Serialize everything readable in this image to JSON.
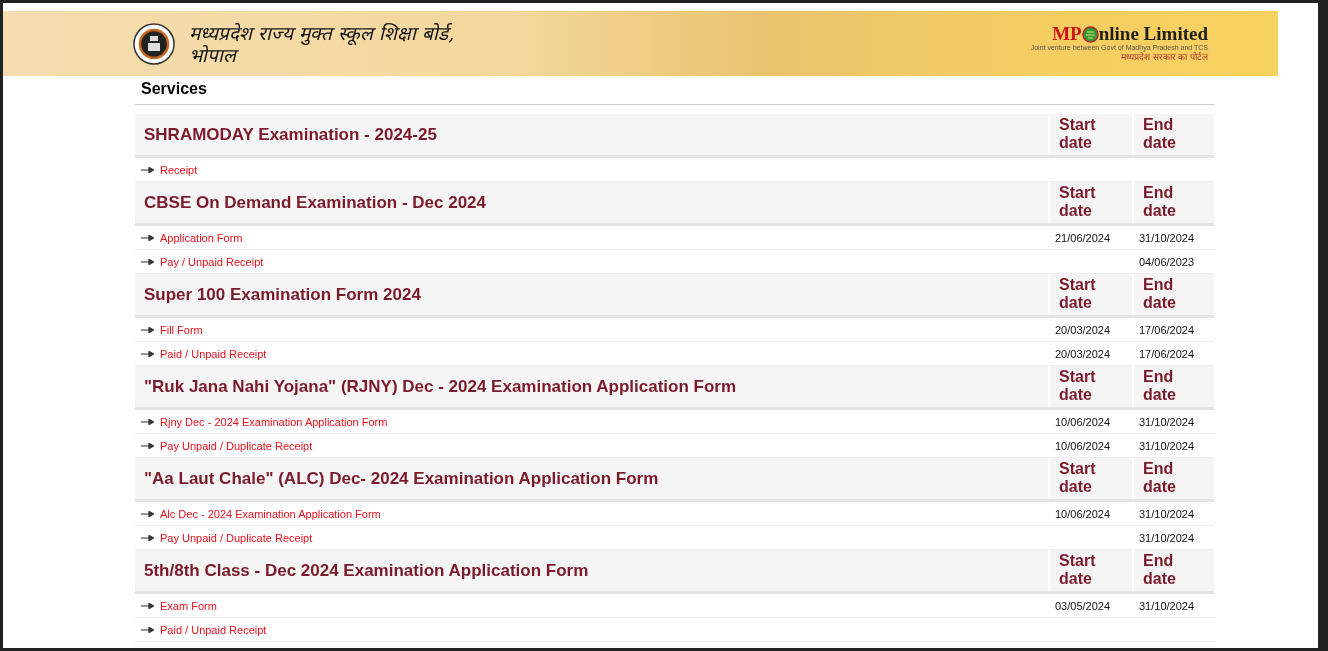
{
  "header": {
    "board_name": "मध्यप्रदेश राज्य मुक्त स्कूल शिक्षा बोर्ड, भोपाल",
    "partner_logo": {
      "brand_a": "MP",
      "brand_b": "nline Limited",
      "fine_print": "Joint venture between Govt of Madhya Pradesh and TCS",
      "tagline": "मध्यप्रदेश सरकार का पोर्टल"
    }
  },
  "page_title": "Services",
  "sections": [
    {
      "title": "SHRAMODAY Examination - 2024-25",
      "start_heading": "Start date",
      "end_heading": "End date",
      "links": [
        {
          "label": "Receipt"
        }
      ]
    },
    {
      "title": "CBSE On Demand Examination - Dec 2024",
      "start_heading": "Start date",
      "end_heading": "End date",
      "links": [
        {
          "label": "Application Form",
          "start": "21/06/2024",
          "end": "31/10/2024"
        },
        {
          "label": "Pay / Unpaid Receipt",
          "end": "04/06/2023"
        }
      ]
    },
    {
      "title": "Super 100 Examination Form 2024",
      "start_heading": "Start date",
      "end_heading": "End date",
      "links": [
        {
          "label": "Fill Form",
          "start": "20/03/2024",
          "end": "17/06/2024"
        },
        {
          "label": "Paid / Unpaid Receipt",
          "start": "20/03/2024",
          "end": "17/06/2024"
        }
      ]
    },
    {
      "title": "\"Ruk Jana Nahi Yojana\" (RJNY) Dec - 2024 Examination Application Form",
      "start_heading": "Start date",
      "end_heading": "End date",
      "links": [
        {
          "label": "Rjny Dec - 2024 Examination Application Form",
          "start": "10/06/2024",
          "end": "31/10/2024"
        },
        {
          "label": "Pay Unpaid / Duplicate Receipt",
          "start": "10/06/2024",
          "end": "31/10/2024"
        }
      ]
    },
    {
      "title": "\"Aa Laut Chale\" (ALC) Dec- 2024 Examination Application Form",
      "start_heading": "Start date",
      "end_heading": "End date",
      "links": [
        {
          "label": "Alc Dec - 2024 Examination Application Form",
          "start": "10/06/2024",
          "end": "31/10/2024"
        },
        {
          "label": "Pay Unpaid / Duplicate Receipt",
          "end": "31/10/2024"
        }
      ]
    },
    {
      "title": "5th/8th Class - Dec 2024 Examination Application Form",
      "start_heading": "Start date",
      "end_heading": "End date",
      "links": [
        {
          "label": "Exam Form",
          "start": "03/05/2024",
          "end": "31/10/2024"
        },
        {
          "label": "Paid / Unpaid Receipt"
        }
      ]
    }
  ]
}
